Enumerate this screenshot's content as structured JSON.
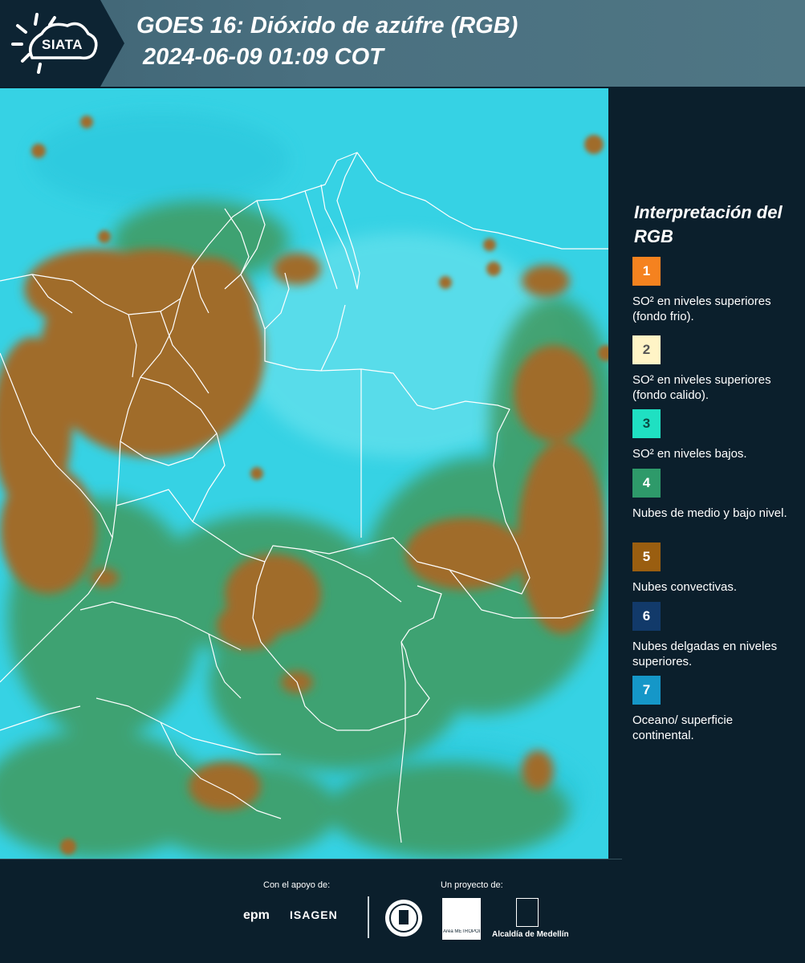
{
  "header": {
    "logo_text": "SIATA",
    "title_line1": "GOES 16: Dióxido de azúfre (RGB)",
    "title_line2": "2024-06-09 01:09 COT"
  },
  "legend": {
    "title": "Interpretación del RGB",
    "items": [
      {
        "number": "1",
        "color": "#f5821f",
        "text_color": "#ffffff",
        "description": "SO² en niveles superiores (fondo frio)."
      },
      {
        "number": "2",
        "color": "#fff4c6",
        "text_color": "#555555",
        "description": "SO² en niveles superiores (fondo calido)."
      },
      {
        "number": "3",
        "color": "#1fe0c2",
        "text_color": "#0b4a44",
        "description": "SO² en niveles bajos."
      },
      {
        "number": "4",
        "color": "#2e9a6a",
        "text_color": "#ffffff",
        "description": "Nubes de medio y bajo nivel."
      },
      {
        "number": "5",
        "color": "#9a5e10",
        "text_color": "#ffffff",
        "description": "Nubes convectivas."
      },
      {
        "number": "6",
        "color": "#123a6a",
        "text_color": "#ffffff",
        "description": "Nubes delgadas en niveles superiores."
      },
      {
        "number": "7",
        "color": "#1597c8",
        "text_color": "#ffffff",
        "description": "Oceano/ superficie continental."
      }
    ]
  },
  "footer": {
    "support_label": "Con el apoyo de:",
    "project_label": "Un proyecto de:",
    "sponsor1": "epm",
    "sponsor2": "ISAGEN",
    "partner_metro": "Área METROPOLITANA Valle de Aburrá",
    "partner_alcaldia": "Alcaldía de Medellín"
  },
  "colors": {
    "ocean_cyan": "#34d3e3",
    "cloud_brown": "#a06c2a",
    "mid_cloud_green": "#3f9a5e",
    "border_line": "#ffffff"
  }
}
